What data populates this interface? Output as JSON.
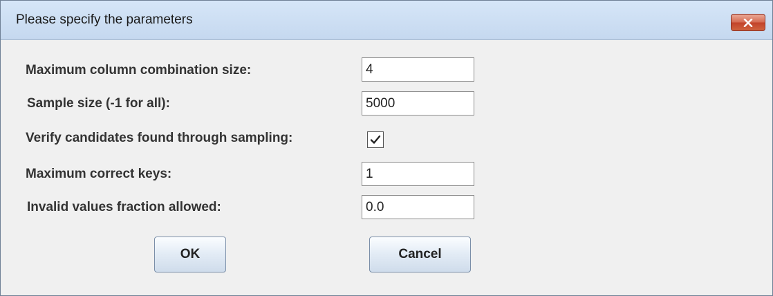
{
  "window": {
    "title": "Please specify the parameters",
    "close_icon": "close-x-icon"
  },
  "form": {
    "max_combination": {
      "label": "Maximum column combination size:",
      "value": "4"
    },
    "sample_size": {
      "label": "Sample size (-1 for all):",
      "value": "5000"
    },
    "verify_candidates": {
      "label": "Verify candidates found through sampling:",
      "checked": true
    },
    "max_correct_keys": {
      "label": "Maximum correct keys:",
      "value": "1"
    },
    "invalid_fraction": {
      "label": "Invalid values fraction allowed:",
      "value": "0.0"
    }
  },
  "buttons": {
    "ok": "OK",
    "cancel": "Cancel"
  },
  "colors": {
    "title_bar": "#c5d8ef",
    "close_button": "#c2432a",
    "dialog_background": "#f0f0f0"
  }
}
